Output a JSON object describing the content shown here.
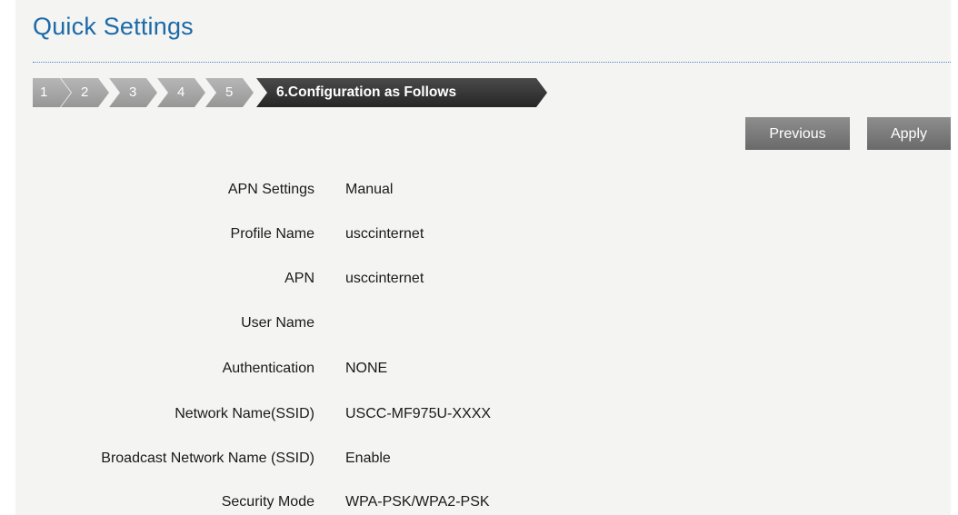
{
  "page": {
    "title": "Quick Settings"
  },
  "wizard": {
    "steps": [
      {
        "label": "1",
        "active": false
      },
      {
        "label": "2",
        "active": false
      },
      {
        "label": "3",
        "active": false
      },
      {
        "label": "4",
        "active": false
      },
      {
        "label": "5",
        "active": false
      },
      {
        "label": "6.Configuration as Follows",
        "active": true
      }
    ]
  },
  "actions": {
    "previous_label": "Previous",
    "apply_label": "Apply"
  },
  "summary": [
    {
      "label": "APN Settings",
      "value": "Manual"
    },
    {
      "label": "Profile Name",
      "value": "usccinternet"
    },
    {
      "label": "APN",
      "value": "usccinternet"
    },
    {
      "label": "User Name",
      "value": ""
    },
    {
      "label": "Authentication",
      "value": "NONE"
    },
    {
      "label": "Network Name(SSID)",
      "value": "USCC-MF975U-XXXX"
    },
    {
      "label": "Broadcast Network Name (SSID)",
      "value": "Enable"
    },
    {
      "label": "Security Mode",
      "value": "WPA-PSK/WPA2-PSK"
    }
  ],
  "colors": {
    "title": "#1c6aa8",
    "step_inactive": "#a8a8a8",
    "step_active": "#333333",
    "button": "#7b7b7b",
    "background": "#f4f4f2"
  }
}
